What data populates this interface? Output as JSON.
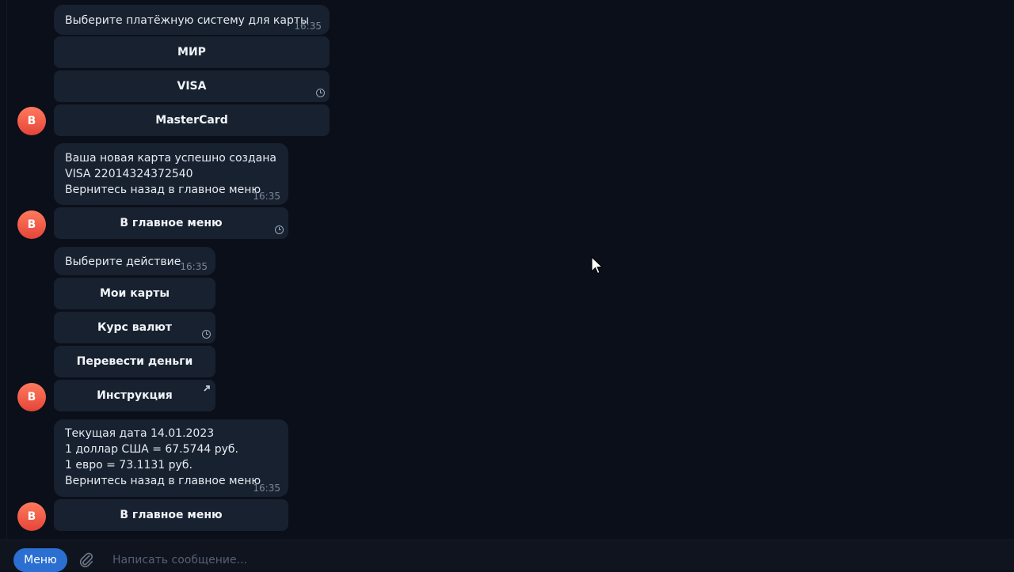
{
  "messages": [
    {
      "text": "Выберите платёжную систему для карты",
      "time": "16:35",
      "buttons": [
        "МИР",
        "VISA",
        "MasterCard"
      ],
      "avatar": "B"
    },
    {
      "lines": [
        "Ваша новая карта успешно создана",
        "VISA 22014324372540",
        "Вернитесь назад в главное меню"
      ],
      "time": "16:35",
      "buttons": [
        "В главное меню"
      ],
      "avatar": "B"
    },
    {
      "text": "Выберите действие",
      "time": "16:35",
      "buttons": [
        "Мои карты",
        "Курс валют",
        "Перевести деньги",
        "Инструкция"
      ],
      "avatar": "B"
    },
    {
      "lines": [
        "Текущая дата 14.01.2023",
        "1 доллар США = 67.5744 руб.",
        "1 евро = 73.1131 руб.",
        "Вернитесь назад в главное меню"
      ],
      "time": "16:35",
      "buttons": [
        "В главное меню"
      ],
      "avatar": "B"
    }
  ],
  "composer": {
    "menu_label": "Меню",
    "placeholder": "Написать сообщение..."
  },
  "icons": {
    "pending": "clock-icon",
    "inline_link": "arrow-up-right-icon",
    "attach": "paperclip-icon",
    "pointer": "mouse-cursor-icon"
  },
  "colors": {
    "background": "#0b0f1a",
    "bubble": "#182130",
    "avatar": "#e5453a",
    "accent": "#2a6fd1"
  }
}
